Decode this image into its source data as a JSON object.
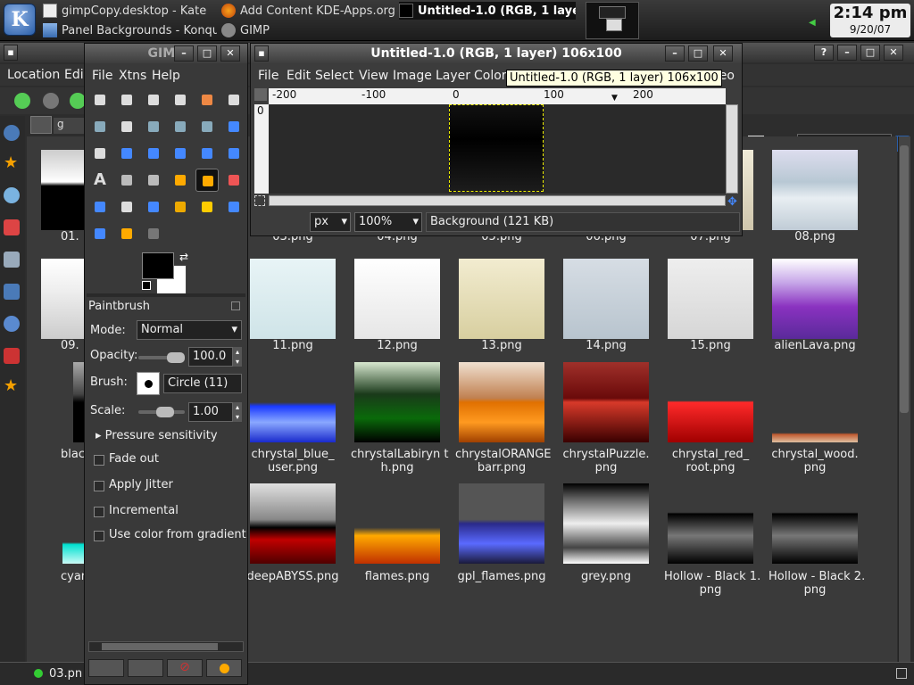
{
  "taskbar": {
    "tasks": [
      {
        "label": "gimpCopy.desktop - Kate"
      },
      {
        "label": "Add Content KDE-Apps.org"
      },
      {
        "label": "Untitled-1.0 (RGB, 1 layer)"
      },
      {
        "label": "Panel Backgrounds - Konqu"
      },
      {
        "label": "GIMP"
      }
    ],
    "clock": {
      "time": "2:14 pm",
      "date": "9/20/07"
    }
  },
  "konqueror": {
    "menu": [
      "Location",
      "Edi"
    ],
    "thumbnails": [
      {
        "label": "01."
      },
      {
        "label": "03.png"
      },
      {
        "label": "04.png"
      },
      {
        "label": "05.png"
      },
      {
        "label": "06.png"
      },
      {
        "label": "07.png"
      },
      {
        "label": "08.png"
      },
      {
        "label": "09."
      },
      {
        "label": "11.png"
      },
      {
        "label": "12.png"
      },
      {
        "label": "13.png"
      },
      {
        "label": "14.png"
      },
      {
        "label": "15.png"
      },
      {
        "label": "alienLava.png"
      },
      {
        "label": "blackb"
      },
      {
        "label": "chrystal_blue_\nuser.png"
      },
      {
        "label": "chrystalLabiryn t\nh.png"
      },
      {
        "label": "chrystalORANGE\nbarr.png"
      },
      {
        "label": "chrystalPuzzle.\npng"
      },
      {
        "label": "chrystal_red_\nroot.png"
      },
      {
        "label": "chrystal_wood.\npng"
      },
      {
        "label": "cyan"
      },
      {
        "label": "deepABYSS.png"
      },
      {
        "label": "flames.png"
      },
      {
        "label": "gpl_flames.png"
      },
      {
        "label": "grey.png"
      },
      {
        "label": "Hollow - Black 1.\npng"
      },
      {
        "label": "Hollow - Black 2.\npng"
      }
    ],
    "status": "03.pn"
  },
  "toolbox": {
    "title": "GIMP",
    "menu": [
      "File",
      "Xtns",
      "Help"
    ],
    "tool_name": "Paintbrush",
    "mode_label": "Mode:",
    "mode_value": "Normal",
    "opacity_label": "Opacity:",
    "opacity_value": "100.0",
    "brush_label": "Brush:",
    "brush_value": "Circle (11)",
    "scale_label": "Scale:",
    "scale_value": "1.00",
    "pressure": "Pressure sensitivity",
    "options": [
      "Fade out",
      "Apply Jitter",
      "Incremental",
      "Use color from gradient"
    ]
  },
  "image_window": {
    "title": "Untitled-1.0 (RGB, 1 layer) 106x100",
    "menu": [
      "File",
      "Edit",
      "Select",
      "View",
      "Image",
      "Layer",
      "Colors",
      "ideo"
    ],
    "ruler_labels": [
      "-200",
      "-100",
      "0",
      "100",
      "200"
    ],
    "vruler_label": "0",
    "unit": "px",
    "zoom": "100%",
    "layer_info": "Background (121 KB)",
    "tooltip": "Untitled-1.0 (RGB, 1 layer) 106x100"
  },
  "colors": {
    "accent": "#2a5ea8",
    "tooltip_bg": "#ffffe1"
  }
}
